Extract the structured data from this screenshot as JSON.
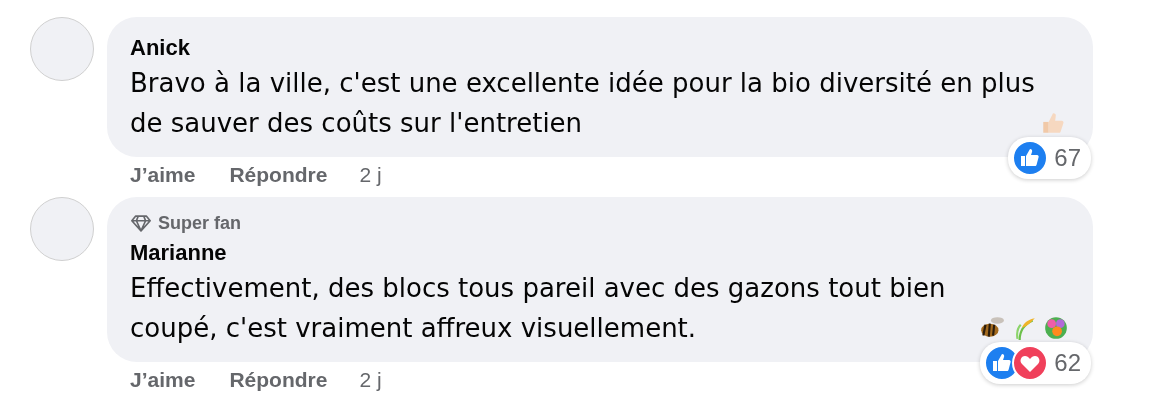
{
  "comments": [
    {
      "author": "Anick",
      "text": "Bravo à la ville, c'est une excellente idée pour la bio diversité en plus de sauver des coûts sur l'entretien",
      "emoji": [
        {
          "kind": "thumbs-up"
        }
      ],
      "reactions": [
        {
          "kind": "like"
        }
      ],
      "reaction_count": "67",
      "actions": [
        "J’aime",
        "Répondre"
      ],
      "time": "2 j"
    },
    {
      "badge": "Super fan",
      "author": "Marianne",
      "text": "Effectivement, des blocs tous pareil avec des gazons tout bien coupé, c'est vraiment affreux visuellement.",
      "emoji": [
        {
          "kind": "bee"
        },
        {
          "kind": "grain"
        },
        {
          "kind": "bouquet"
        }
      ],
      "reactions": [
        {
          "kind": "like"
        },
        {
          "kind": "love"
        }
      ],
      "reaction_count": "62",
      "actions": [
        "J’aime",
        "Répondre"
      ],
      "time": "2 j"
    }
  ]
}
